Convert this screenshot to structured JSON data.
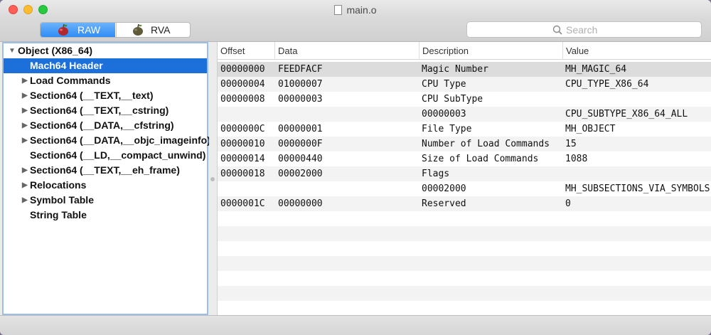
{
  "window": {
    "title": "main.o"
  },
  "toolbar": {
    "raw_label": "RAW",
    "rva_label": "RVA",
    "search_placeholder": "Search"
  },
  "sidebar": {
    "items": [
      {
        "label": "Object  (X86_64)",
        "level": 0,
        "expanded": true,
        "has_children": true
      },
      {
        "label": "Mach64 Header",
        "level": 1,
        "selected": true,
        "has_children": false
      },
      {
        "label": "Load Commands",
        "level": 1,
        "has_children": true
      },
      {
        "label": "Section64 (__TEXT,__text)",
        "level": 1,
        "has_children": true
      },
      {
        "label": "Section64 (__TEXT,__cstring)",
        "level": 1,
        "has_children": true
      },
      {
        "label": "Section64 (__DATA,__cfstring)",
        "level": 1,
        "has_children": true
      },
      {
        "label": "Section64 (__DATA,__objc_imageinfo)",
        "level": 1,
        "has_children": true
      },
      {
        "label": "Section64 (__LD,__compact_unwind)",
        "level": 1,
        "has_children": false
      },
      {
        "label": "Section64 (__TEXT,__eh_frame)",
        "level": 1,
        "has_children": true
      },
      {
        "label": "Relocations",
        "level": 1,
        "has_children": true
      },
      {
        "label": "Symbol Table",
        "level": 1,
        "has_children": true
      },
      {
        "label": "String Table",
        "level": 1,
        "has_children": false
      }
    ]
  },
  "table": {
    "columns": [
      "Offset",
      "Data",
      "Description",
      "Value"
    ],
    "rows": [
      [
        "00000000",
        "FEEDFACF",
        "Magic Number",
        "MH_MAGIC_64"
      ],
      [
        "00000004",
        "01000007",
        "CPU Type",
        "CPU_TYPE_X86_64"
      ],
      [
        "00000008",
        "00000003",
        "CPU SubType",
        ""
      ],
      [
        "",
        "",
        "00000003",
        "CPU_SUBTYPE_X86_64_ALL"
      ],
      [
        "0000000C",
        "00000001",
        "File Type",
        "MH_OBJECT"
      ],
      [
        "00000010",
        "0000000F",
        "Number of Load Commands",
        "15"
      ],
      [
        "00000014",
        "00000440",
        "Size of Load Commands",
        "1088"
      ],
      [
        "00000018",
        "00002000",
        "Flags",
        ""
      ],
      [
        "",
        "",
        "00002000",
        "MH_SUBSECTIONS_VIA_SYMBOLS"
      ],
      [
        "0000001C",
        "00000000",
        "Reserved",
        "0"
      ]
    ]
  },
  "colors": {
    "selection": "#1d6fd9",
    "accent": "#2f8cf5"
  }
}
